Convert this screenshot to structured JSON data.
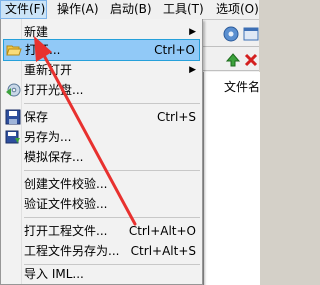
{
  "menubar": {
    "items": [
      {
        "label": "文件(F)"
      },
      {
        "label": "操作(A)"
      },
      {
        "label": "启动(B)"
      },
      {
        "label": "工具(T)"
      },
      {
        "label": "选项(O)"
      }
    ]
  },
  "background_app": {
    "column_header": "文件名"
  },
  "file_menu": {
    "items": [
      {
        "label": "新建",
        "shortcut": "",
        "submenu": true
      },
      {
        "label": "打开...",
        "shortcut": "Ctrl+O",
        "submenu": false
      },
      {
        "label": "重新打开",
        "shortcut": "",
        "submenu": true
      },
      {
        "label": "打开光盘...",
        "shortcut": "",
        "submenu": false
      },
      {
        "label": "保存",
        "shortcut": "Ctrl+S",
        "submenu": false
      },
      {
        "label": "另存为...",
        "shortcut": "",
        "submenu": false
      },
      {
        "label": "模拟保存...",
        "shortcut": "",
        "submenu": false
      },
      {
        "label": "创建文件校验...",
        "shortcut": "",
        "submenu": false
      },
      {
        "label": "验证文件校验...",
        "shortcut": "",
        "submenu": false
      },
      {
        "label": "打开工程文件...",
        "shortcut": "Ctrl+Alt+O",
        "submenu": false
      },
      {
        "label": "工程文件另存为...",
        "shortcut": "Ctrl+Alt+S",
        "submenu": false
      },
      {
        "label": "导入 IML...",
        "shortcut": "",
        "submenu": false
      }
    ]
  },
  "icons": {
    "open": "folder-open-icon",
    "open_disc": "disc-icon",
    "save": "floppy-disk-icon"
  },
  "colors": {
    "highlight": "#91c9f7",
    "highlight_border": "#26a0da",
    "annotation_arrow": "#e8312f"
  }
}
